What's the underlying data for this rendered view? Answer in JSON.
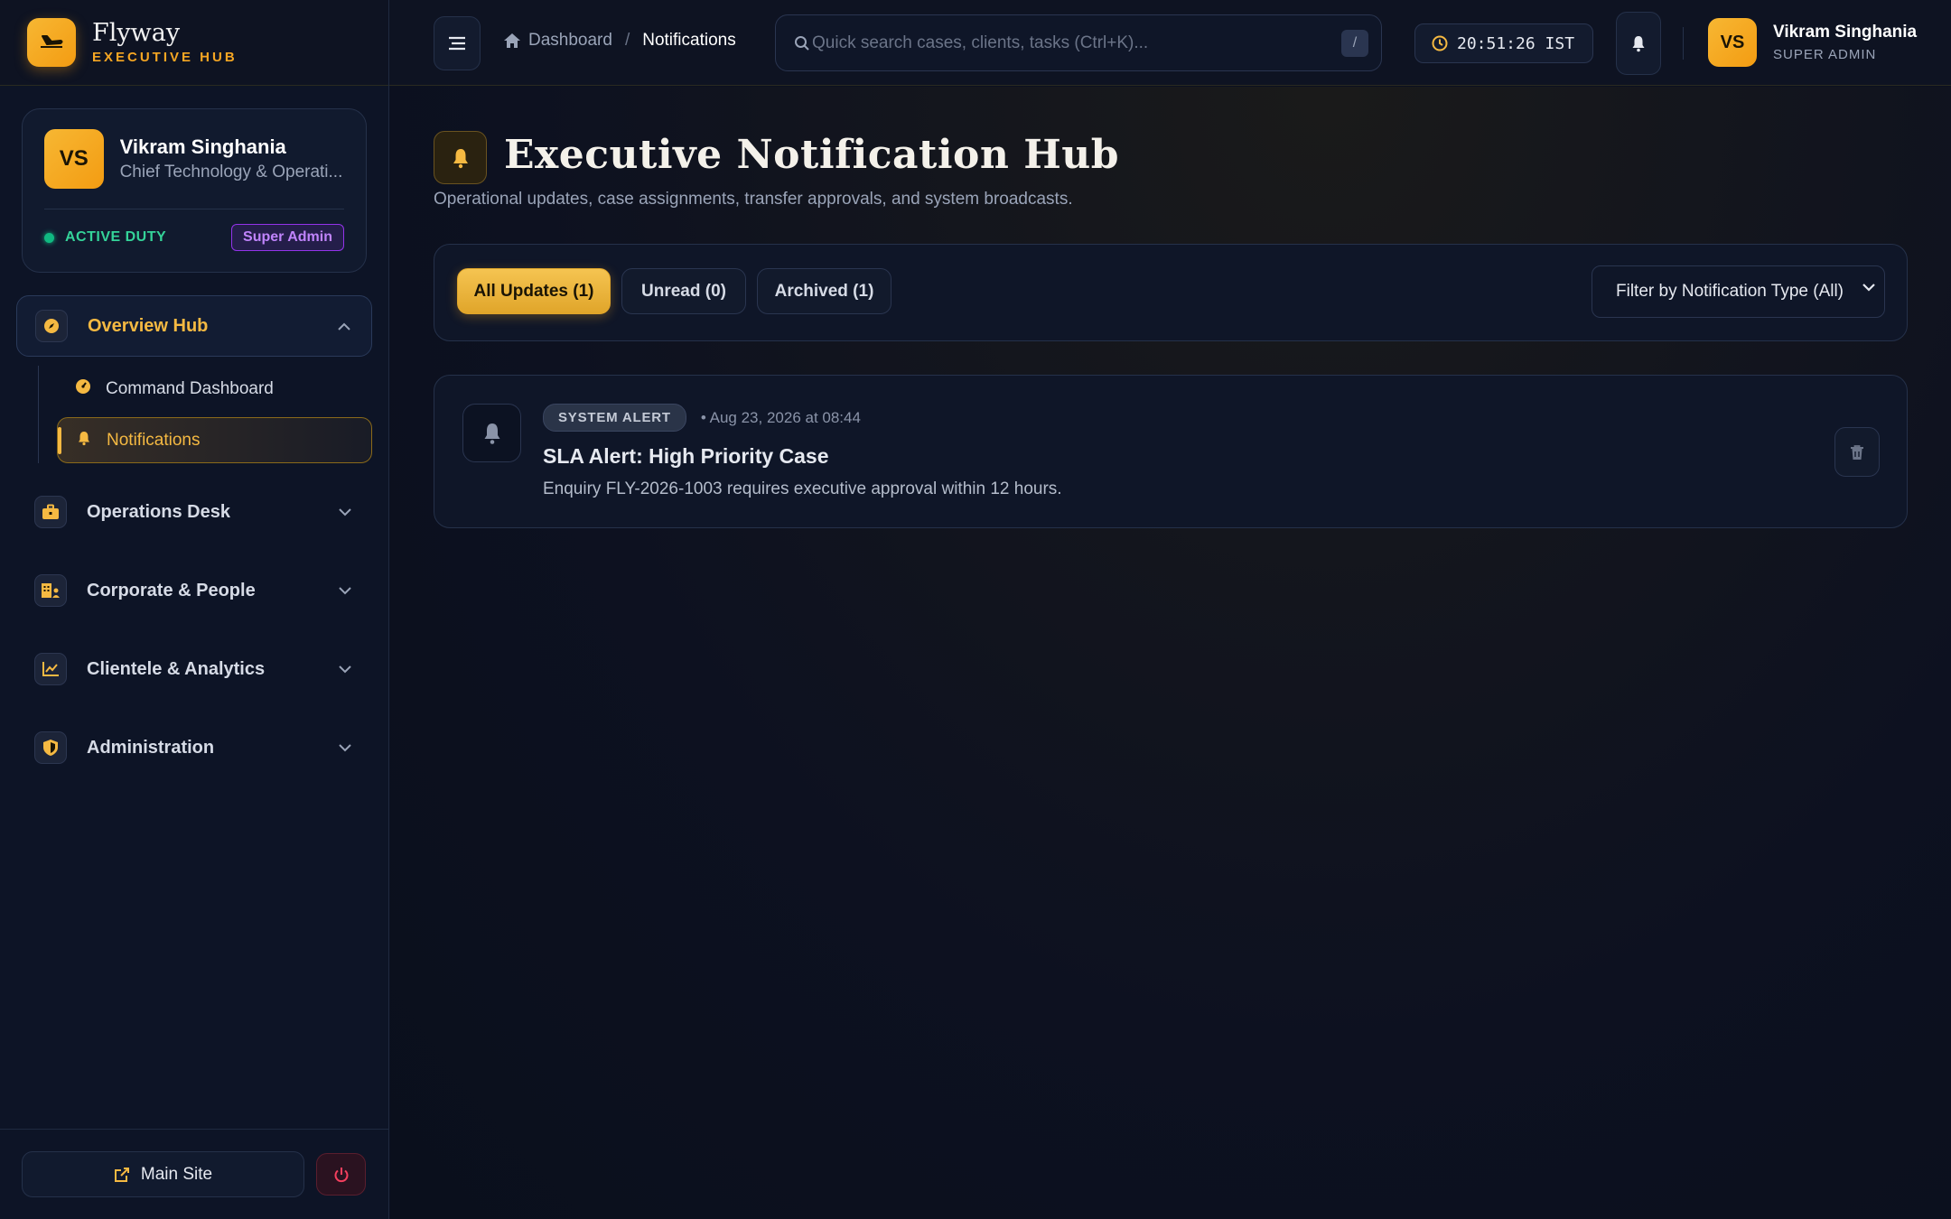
{
  "brand": {
    "name": "Flyway",
    "subtitle": "EXECUTIVE HUB"
  },
  "profile": {
    "initials": "VS",
    "name": "Vikram Singhania",
    "role": "Chief Technology & Operati...",
    "status": "ACTIVE DUTY",
    "badge": "Super Admin"
  },
  "nav": {
    "overview": {
      "label": "Overview Hub",
      "items": [
        {
          "label": "Command Dashboard"
        },
        {
          "label": "Notifications"
        }
      ]
    },
    "groups": [
      {
        "label": "Operations Desk"
      },
      {
        "label": "Corporate & People"
      },
      {
        "label": "Clientele & Analytics"
      },
      {
        "label": "Administration"
      }
    ]
  },
  "footer": {
    "main_site": "Main Site"
  },
  "topbar": {
    "breadcrumb_home": "Dashboard",
    "breadcrumb_sep": "/",
    "breadcrumb_current": "Notifications",
    "search_placeholder": "Quick search cases, clients, tasks (Ctrl+K)...",
    "search_shortcut": "/",
    "clock": "20:51:26 IST",
    "user_initials": "VS",
    "user_name": "Vikram Singhania",
    "user_role": "SUPER ADMIN"
  },
  "page": {
    "title": "Executive Notification Hub",
    "subtitle": "Operational updates, case assignments, transfer approvals, and system broadcasts."
  },
  "filters": {
    "tabs": [
      {
        "label": "All Updates (1)"
      },
      {
        "label": "Unread (0)"
      },
      {
        "label": "Archived (1)"
      }
    ],
    "type_select": "Filter by Notification Type (All)"
  },
  "notifications": [
    {
      "type": "SYSTEM ALERT",
      "time": "• Aug 23, 2026 at 08:44",
      "title": "SLA Alert: High Priority Case",
      "body": "Enquiry FLY-2026-1003 requires executive approval within 12 hours."
    }
  ],
  "colors": {
    "accent": "#f5b942",
    "background": "#0b1020",
    "success": "#10b981",
    "admin_badge": "#9333ea"
  }
}
